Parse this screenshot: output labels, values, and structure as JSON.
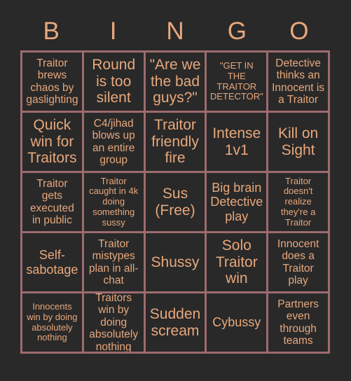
{
  "card": {
    "header_letters": [
      "B",
      "I",
      "N",
      "G",
      "O"
    ],
    "colors": {
      "background": "#292929",
      "text": "#e8a87c",
      "border": "#9d6b6e"
    },
    "rows": [
      [
        {
          "text": "Traitor brews chaos by gaslighting",
          "size": "fs-md"
        },
        {
          "text": "Round is too silent",
          "size": "fs-xl"
        },
        {
          "text": "\"Are we the bad guys?\"",
          "size": "fs-xl"
        },
        {
          "text": "\"GET IN THE TRAITOR DETECTOR\"",
          "size": "fs-sm"
        },
        {
          "text": "Detective thinks an Innocent is a Traitor",
          "size": "fs-md"
        }
      ],
      [
        {
          "text": "Quick win for Traitors",
          "size": "fs-xl"
        },
        {
          "text": "C4/jihad blows up an entire group",
          "size": "fs-md"
        },
        {
          "text": "Traitor friendly fire",
          "size": "fs-xl"
        },
        {
          "text": "Intense 1v1",
          "size": "fs-xl"
        },
        {
          "text": "Kill on Sight",
          "size": "fs-xl"
        }
      ],
      [
        {
          "text": "Traitor gets executed in public",
          "size": "fs-md"
        },
        {
          "text": "Traitor caught in 4k doing something sussy",
          "size": "fs-sm"
        },
        {
          "text": "Sus (Free)",
          "size": "fs-xl"
        },
        {
          "text": "Big brain Detective play",
          "size": "fs-lg"
        },
        {
          "text": "Traitor doesn't realize they're a Traitor",
          "size": "fs-sm"
        }
      ],
      [
        {
          "text": "Self-sabotage",
          "size": "fs-lg"
        },
        {
          "text": "Traitor mistypes plan in all-chat",
          "size": "fs-md"
        },
        {
          "text": "Shussy",
          "size": "fs-xl"
        },
        {
          "text": "Solo Traitor win",
          "size": "fs-xl"
        },
        {
          "text": "Innocent does a Traitor play",
          "size": "fs-md"
        }
      ],
      [
        {
          "text": "Innocents win by doing absolutely nothing",
          "size": "fs-sm"
        },
        {
          "text": "Traitors win by doing absolutely nothing",
          "size": "fs-md"
        },
        {
          "text": "Sudden scream",
          "size": "fs-xl"
        },
        {
          "text": "Cybussy",
          "size": "fs-lg"
        },
        {
          "text": "Partners even through teams",
          "size": "fs-md"
        }
      ]
    ]
  }
}
